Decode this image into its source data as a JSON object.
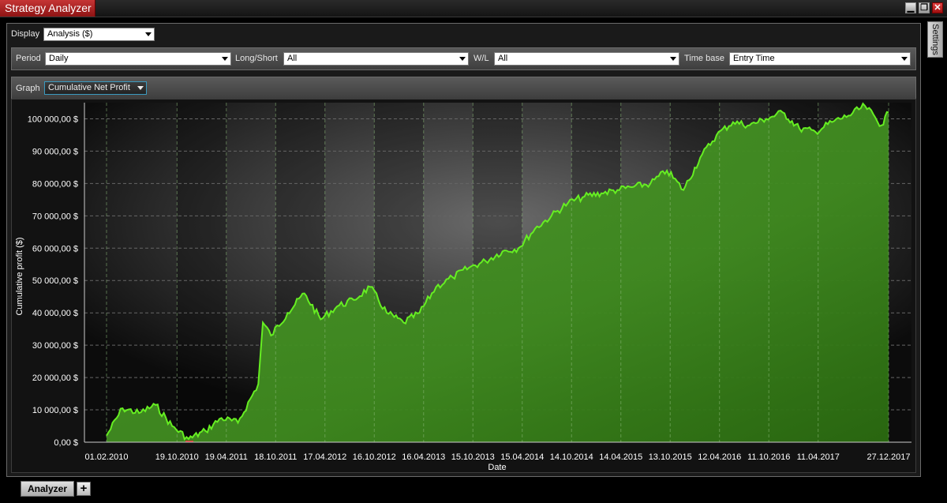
{
  "window": {
    "title": "Strategy Analyzer",
    "minimize": "▁",
    "restore": "❐",
    "close": "✕"
  },
  "settings_tab": "Settings",
  "display": {
    "label": "Display",
    "value": "Analysis ($)"
  },
  "filters": {
    "period": {
      "label": "Period",
      "value": "Daily"
    },
    "long_short": {
      "label": "Long/Short",
      "value": "All"
    },
    "wl": {
      "label": "W/L",
      "value": "All"
    },
    "time_base": {
      "label": "Time base",
      "value": "Entry Time"
    }
  },
  "graph": {
    "label": "Graph",
    "value": "Cumulative Net Profit"
  },
  "tabs": {
    "active": "Analyzer",
    "add": "+"
  },
  "colors": {
    "line": "#66ee22",
    "fill": "#3f8a1f",
    "grid": "#666666",
    "title_red": "#b52222",
    "drawdown": "#dd3333"
  },
  "chart_data": {
    "type": "area",
    "title": "",
    "xlabel": "Date",
    "ylabel": "Cumulative profit ($)",
    "ylim": [
      0,
      105000
    ],
    "y_ticks": [
      0,
      10000,
      20000,
      30000,
      40000,
      50000,
      60000,
      70000,
      80000,
      90000,
      100000
    ],
    "y_tick_labels": [
      "0,00 $",
      "10 000,00 $",
      "20 000,00 $",
      "30 000,00 $",
      "40 000,00 $",
      "50 000,00 $",
      "60 000,00 $",
      "70 000,00 $",
      "80 000,00 $",
      "90 000,00 $",
      "100 000,00 $"
    ],
    "x_tick_labels": [
      "01.02.2010",
      "19.10.2010",
      "19.04.2011",
      "18.10.2011",
      "17.04.2012",
      "16.10.2012",
      "16.04.2013",
      "15.10.2013",
      "15.04.2014",
      "14.10.2014",
      "14.04.2015",
      "13.10.2015",
      "12.04.2016",
      "11.10.2016",
      "11.04.2017",
      "27.12.2017"
    ],
    "grid": true,
    "x": [
      "01.02.2010",
      "01.04.2010",
      "01.06.2010",
      "01.08.2010",
      "01.10.2010",
      "01.12.2010",
      "01.02.2011",
      "01.04.2011",
      "01.06.2011",
      "15.08.2011",
      "01.09.2011",
      "01.10.2011",
      "01.12.2011",
      "01.02.2012",
      "01.04.2012",
      "01.06.2012",
      "01.08.2012",
      "01.10.2012",
      "01.12.2012",
      "01.02.2013",
      "01.04.2013",
      "01.06.2013",
      "01.08.2013",
      "01.10.2013",
      "01.12.2013",
      "01.02.2014",
      "01.04.2014",
      "01.06.2014",
      "01.08.2014",
      "01.10.2014",
      "01.12.2014",
      "01.02.2015",
      "01.04.2015",
      "01.06.2015",
      "01.08.2015",
      "01.10.2015",
      "01.12.2015",
      "01.02.2016",
      "01.04.2016",
      "01.06.2016",
      "01.08.2016",
      "01.10.2016",
      "01.12.2016",
      "01.02.2017",
      "01.04.2017",
      "01.06.2017",
      "01.08.2017",
      "01.10.2017",
      "01.12.2017",
      "27.12.2017"
    ],
    "series": [
      {
        "values": [
          2000,
          10500,
          9000,
          11500,
          5000,
          1000,
          3500,
          7500,
          6000,
          18000,
          37000,
          33000,
          40000,
          46000,
          38000,
          42000,
          44000,
          48000,
          40000,
          37000,
          40000,
          48000,
          51000,
          54000,
          56000,
          59000,
          60000,
          66000,
          70000,
          74000,
          76000,
          77000,
          78000,
          79000,
          80000,
          84000,
          78000,
          88000,
          95000,
          99000,
          98000,
          100000,
          102000,
          97000,
          96000,
          99000,
          101000,
          104000,
          98000,
          102000
        ]
      }
    ]
  }
}
